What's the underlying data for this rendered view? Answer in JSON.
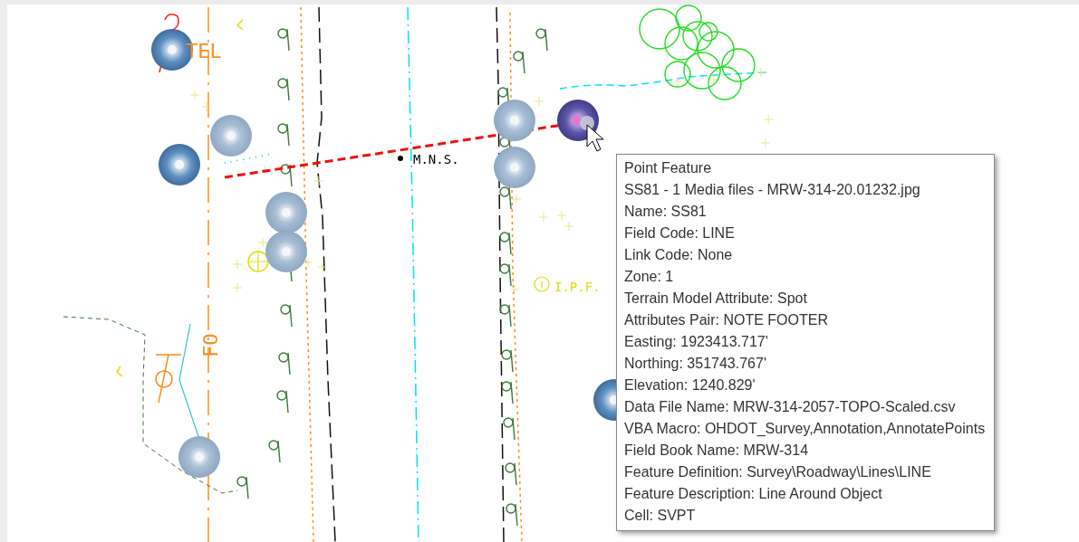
{
  "drawing": {
    "labels": [
      {
        "text": "TEL",
        "color": "#ff8c1a"
      },
      {
        "text": "M.N.S.",
        "color": "#000000"
      },
      {
        "text": "I.P.F.",
        "color": "#e0e000"
      },
      {
        "text": "FO",
        "color": "#ff8c1a"
      }
    ]
  },
  "tooltip": {
    "title": "Point Feature",
    "lines": [
      "SS81 - 1 Media files - MRW-314-20.01232.jpg",
      "Name: SS81",
      "Field Code: LINE",
      "Link Code: None",
      "Zone: 1",
      "Terrain Model Attribute: Spot",
      "Attributes Pair: NOTE FOOTER",
      "Easting: 1923413.717'",
      "Northing: 351743.767'",
      "Elevation: 1240.829'",
      "Data File Name: MRW-314-2057-TOPO-Scaled.csv",
      "VBA Macro: OHDOT_Survey,Annotation,AnnotatePoints",
      "Field Book Name: MRW-314",
      "Feature Definition: Survey\\Roadway\\Lines\\LINE",
      "Feature Description: Line Around Object",
      "Cell: SVPT"
    ]
  }
}
